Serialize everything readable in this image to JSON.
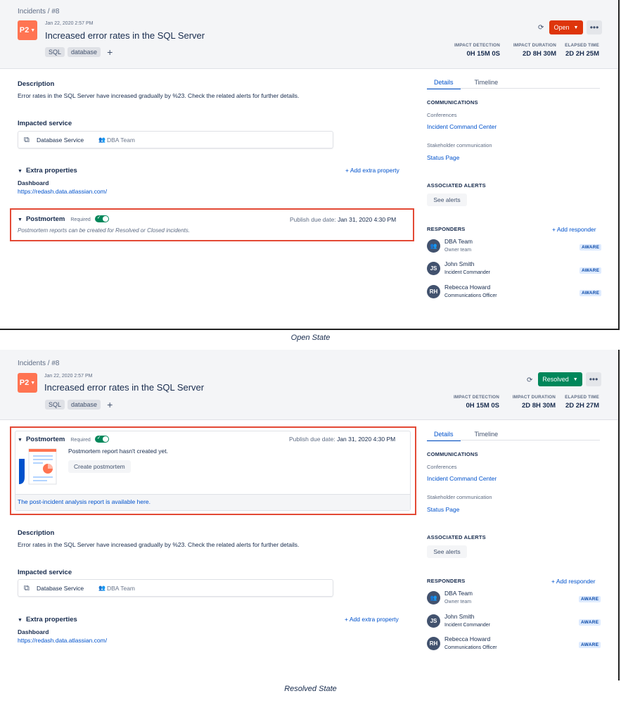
{
  "common": {
    "breadcrumb": "Incidents  /  #8",
    "priority": "P2",
    "date": "Jan 22, 2020 2:57 PM",
    "title": "Increased error rates in the SQL Server",
    "tags": [
      "SQL",
      "database"
    ],
    "metrics": [
      {
        "label": "IMPACT DETECTION",
        "value": "0H 15M 0S"
      },
      {
        "label": "IMPACT DURATION",
        "value": "2D 8H 30M"
      },
      {
        "label": "ELAPSED TIME"
      }
    ],
    "description_heading": "Description",
    "description": "Error rates in the SQL Server have increased gradually by %23. Check the related alerts for further details.",
    "impacted_heading": "Impacted service",
    "service_name": "Database Service",
    "team_name": "DBA Team",
    "extra_heading": "Extra properties",
    "add_extra": "+ Add extra property",
    "dashboard_label": "Dashboard",
    "dashboard_link": "https://redash.data.atlassian.com/",
    "postmortem_heading": "Postmortem",
    "required_label": "Required",
    "due_label": "Publish due date:",
    "due_value": "Jan 31, 2020 4:30 PM",
    "tabs": [
      "Details",
      "Timeline"
    ],
    "communications": "COMMUNICATIONS",
    "conferences": "Conferences",
    "conference_link": "Incident Command Center",
    "stakeholder": "Stakeholder communication",
    "status_page": "Status Page",
    "associated_alerts": "ASSOCIATED ALERTS",
    "see_alerts": "See alerts",
    "responders_heading": "RESPONDERS",
    "add_responder": "+ Add responder",
    "responders": [
      {
        "initials": "",
        "name": "DBA Team",
        "role": "Owner team",
        "badge": "AWARE"
      },
      {
        "initials": "JS",
        "name": "John Smith",
        "role": "Incident Commander",
        "badge": "AWARE"
      },
      {
        "initials": "RH",
        "name": "Rebecca Howard",
        "role": "Communications Officer",
        "badge": "AWARE"
      }
    ]
  },
  "open": {
    "status": "Open",
    "elapsed": "2D 2H 25M",
    "postmortem_note": "Postmortem reports can be created for Resolved or Closed incidents.",
    "caption": "Open State"
  },
  "resolved": {
    "status": "Resolved",
    "elapsed": "2D 2H 27M",
    "pm_message": "Postmortem report hasn't created yet.",
    "create_button": "Create postmortem",
    "pm_footer_link": "The post-incident analysis report is available here.",
    "caption": "Resolved State"
  },
  "colors": {
    "priority": "#ff7452",
    "open": "#de350b",
    "resolved": "#00875a",
    "link": "#0052cc",
    "highlight": "#e34935"
  }
}
